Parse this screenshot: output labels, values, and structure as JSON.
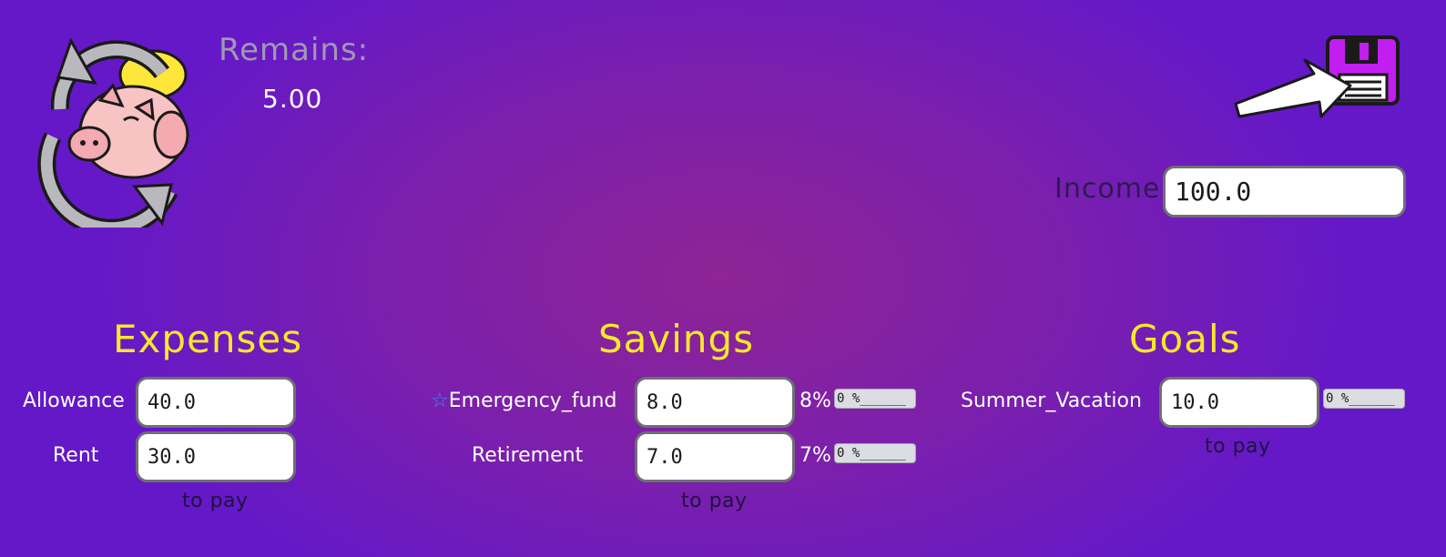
{
  "remains": {
    "label": "Remains:",
    "value": "5.00"
  },
  "income": {
    "label": "Income",
    "value": "100.0"
  },
  "save": {
    "icon": "floppy-disk-icon"
  },
  "logo": {
    "icon": "pig-cycle-logo"
  },
  "colors": {
    "title": "#f6e82a",
    "accent": "#c21ef0",
    "background": "#7a1fae"
  },
  "expenses": {
    "title": "Expenses",
    "items": [
      {
        "label": "Allowance",
        "value": "40.0"
      },
      {
        "label": "Rent",
        "value": "30.0"
      }
    ],
    "to_pay": "to pay"
  },
  "savings": {
    "title": "Savings",
    "items": [
      {
        "star": "☆",
        "label": "Emergency_fund",
        "value": "8.0",
        "percent": "8%",
        "progress_text": "0 %______",
        "progress": 0
      },
      {
        "label": "Retirement",
        "value": "7.0",
        "percent": "7%",
        "progress_text": "0 %______",
        "progress": 0
      }
    ],
    "to_pay": "to pay"
  },
  "goals": {
    "title": "Goals",
    "items": [
      {
        "label": "Summer_Vacation",
        "value": "10.0",
        "progress_text": "0 %______",
        "progress": 0
      }
    ],
    "to_pay": "to pay"
  }
}
